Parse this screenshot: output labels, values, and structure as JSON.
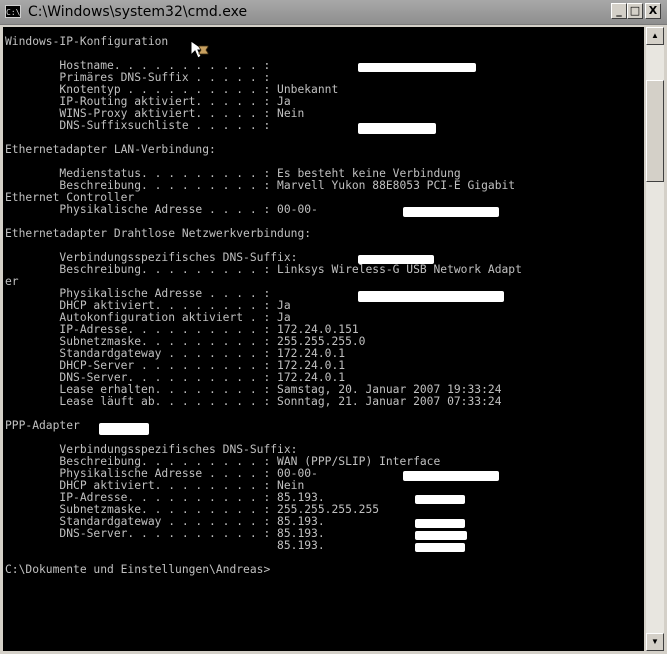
{
  "window": {
    "title": "C:\\Windows\\system32\\cmd.exe",
    "icon_text": "C:\\",
    "icon": "console-app-icon",
    "minimize_glyph": "_",
    "maximize_glyph": "□",
    "close_glyph": "X"
  },
  "console": {
    "lines": [
      "Windows-IP-Konfiguration",
      "",
      "        Hostname. . . . . . . . . . . : ",
      "        Primäres DNS-Suffix . . . . . : ",
      "        Knotentyp . . . . . . . . . . : Unbekannt",
      "        IP-Routing aktiviert. . . . . : Ja",
      "        WINS-Proxy aktiviert. . . . . : Nein",
      "        DNS-Suffixsuchliste . . . . . : ",
      "",
      "Ethernetadapter LAN-Verbindung:",
      "",
      "        Medienstatus. . . . . . . . . : Es besteht keine Verbindung",
      "        Beschreibung. . . . . . . . . : Marvell Yukon 88E8053 PCI-E Gigabit",
      "Ethernet Controller",
      "        Physikalische Adresse . . . . : 00-00-",
      "",
      "Ethernetadapter Drahtlose Netzwerkverbindung:",
      "",
      "        Verbindungsspezifisches DNS-Suffix: ",
      "        Beschreibung. . . . . . . . . : Linksys Wireless-G USB Network Adapt",
      "er",
      "        Physikalische Adresse . . . . : ",
      "        DHCP aktiviert. . . . . . . . : Ja",
      "        Autokonfiguration aktiviert . : Ja",
      "        IP-Adresse. . . . . . . . . . : 172.24.0.151",
      "        Subnetzmaske. . . . . . . . . : 255.255.255.0",
      "        Standardgateway . . . . . . . : 172.24.0.1",
      "        DHCP-Server . . . . . . . . . : 172.24.0.1",
      "        DNS-Server. . . . . . . . . . : 172.24.0.1",
      "        Lease erhalten. . . . . . . . : Samstag, 20. Januar 2007 19:33:24",
      "        Lease läuft ab. . . . . . . . : Sonntag, 21. Januar 2007 07:33:24",
      "",
      "PPP-Adapter         :",
      "",
      "        Verbindungsspezifisches DNS-Suffix:",
      "        Beschreibung. . . . . . . . . : WAN (PPP/SLIP) Interface",
      "        Physikalische Adresse . . . . : 00-00-",
      "        DHCP aktiviert. . . . . . . . : Nein",
      "        IP-Adresse. . . . . . . . . . : 85.193.",
      "        Subnetzmaske. . . . . . . . . : 255.255.255.255",
      "        Standardgateway . . . . . . . : 85.193.",
      "        DNS-Server. . . . . . . . . . : 85.193.",
      "                                        85.193.",
      "",
      "C:\\Dokumente und Einstellungen\\Andreas>"
    ]
  },
  "scrollbar": {
    "up_arrow": "▲",
    "down_arrow": "▼"
  }
}
